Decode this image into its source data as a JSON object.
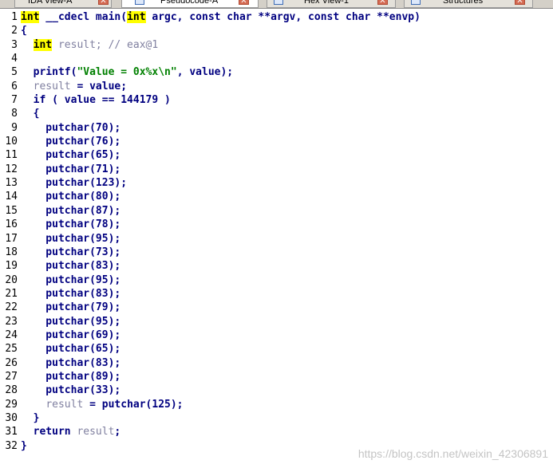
{
  "tabs": [
    {
      "label": "IDA View-A",
      "active": false
    },
    {
      "label": "Pseudocode-A",
      "active": true
    },
    {
      "label": "Hex View-1",
      "active": false
    },
    {
      "label": "Structures",
      "active": false
    }
  ],
  "code": {
    "lines": [
      {
        "n": "1",
        "html": "<span class=\"hl\">int</span> __cdecl main(<span class=\"hl\">int</span> argc, const char **argv, const char **envp)"
      },
      {
        "n": "2",
        "html": "{"
      },
      {
        "n": "3",
        "html": "  <span class=\"hl\">int</span> <span class=\"gray\">result; // eax@1</span>"
      },
      {
        "n": "4",
        "html": ""
      },
      {
        "n": "5",
        "html": "  printf(<span class=\"str\">\"Value = 0x%x\\n\"</span>, value);"
      },
      {
        "n": "6",
        "html": "  <span class=\"gray\">result</span> = value;"
      },
      {
        "n": "7",
        "html": "  if ( value == 144179 )"
      },
      {
        "n": "8",
        "html": "  {"
      },
      {
        "n": "9",
        "html": "    putchar(70);"
      },
      {
        "n": "10",
        "html": "    putchar(76);"
      },
      {
        "n": "11",
        "html": "    putchar(65);"
      },
      {
        "n": "12",
        "html": "    putchar(71);"
      },
      {
        "n": "13",
        "html": "    putchar(123);"
      },
      {
        "n": "14",
        "html": "    putchar(80);"
      },
      {
        "n": "15",
        "html": "    putchar(87);"
      },
      {
        "n": "16",
        "html": "    putchar(78);"
      },
      {
        "n": "17",
        "html": "    putchar(95);"
      },
      {
        "n": "18",
        "html": "    putchar(73);"
      },
      {
        "n": "19",
        "html": "    putchar(83);"
      },
      {
        "n": "20",
        "html": "    putchar(95);"
      },
      {
        "n": "21",
        "html": "    putchar(83);"
      },
      {
        "n": "22",
        "html": "    putchar(79);"
      },
      {
        "n": "23",
        "html": "    putchar(95);"
      },
      {
        "n": "24",
        "html": "    putchar(69);"
      },
      {
        "n": "25",
        "html": "    putchar(65);"
      },
      {
        "n": "26",
        "html": "    putchar(83);"
      },
      {
        "n": "27",
        "html": "    putchar(89);"
      },
      {
        "n": "28",
        "html": "    putchar(33);"
      },
      {
        "n": "29",
        "html": "    <span class=\"gray\">result</span> = putchar(125);"
      },
      {
        "n": "30",
        "html": "  }"
      },
      {
        "n": "31",
        "html": "  return <span class=\"gray\">result</span>;"
      },
      {
        "n": "32",
        "html": "}"
      }
    ]
  },
  "watermark": "https://blog.csdn.net/weixin_42306891",
  "icons": {
    "tab": "document-icon",
    "close": "close-icon"
  }
}
